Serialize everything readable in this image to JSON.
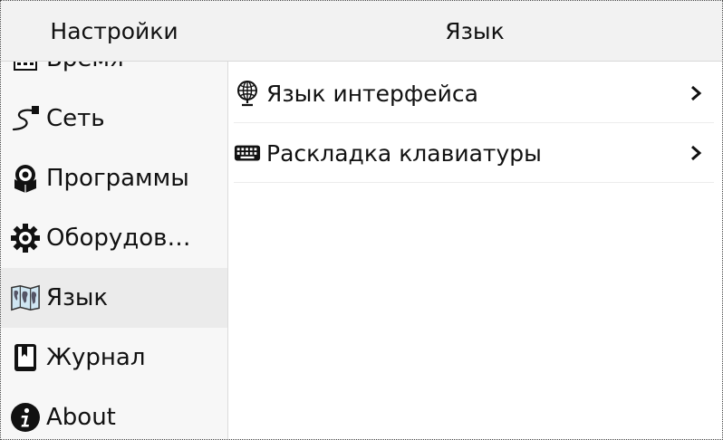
{
  "header": {
    "left_title": "Настройки",
    "right_title": "Язык"
  },
  "sidebar": {
    "items": [
      {
        "label": "Время",
        "icon": "calendar-icon"
      },
      {
        "label": "Сеть",
        "icon": "network-cable-icon"
      },
      {
        "label": "Программы",
        "icon": "packages-icon"
      },
      {
        "label": "Оборудов…",
        "icon": "gear-icon"
      },
      {
        "label": "Язык",
        "icon": "world-map-icon",
        "active": true
      },
      {
        "label": "Журнал",
        "icon": "journal-book-icon"
      },
      {
        "label": "About",
        "icon": "info-icon"
      }
    ]
  },
  "main": {
    "rows": [
      {
        "label": "Язык интерфейса",
        "icon": "globe-icon"
      },
      {
        "label": "Раскладка клавиатуры",
        "icon": "keyboard-icon"
      }
    ]
  }
}
